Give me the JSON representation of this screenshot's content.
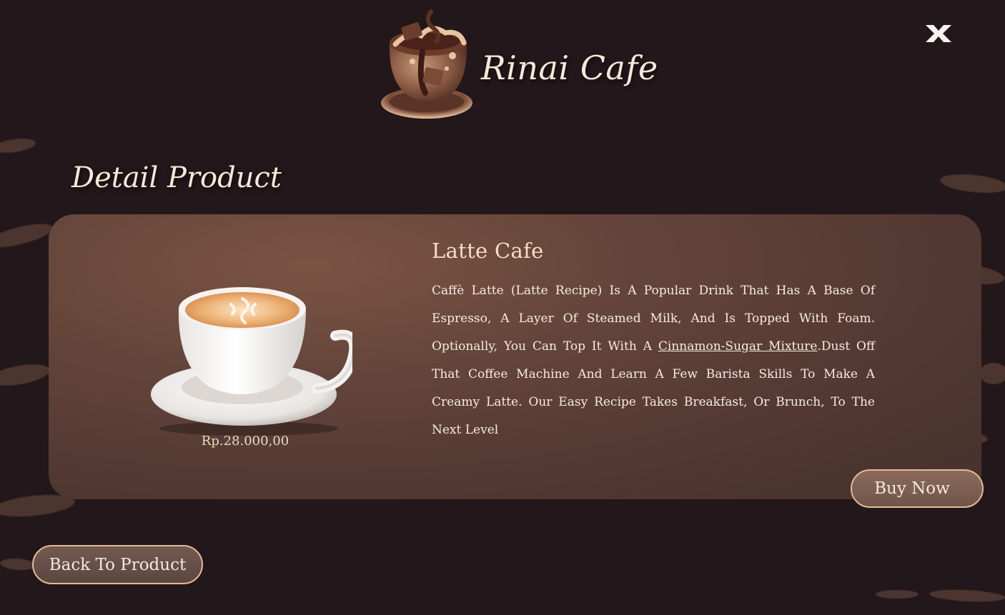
{
  "header": {
    "brand_name": "Rinai Cafe",
    "logo_icon": "coffee-cup-logo-icon",
    "close_icon": "close-icon"
  },
  "page": {
    "heading": "Detail Product"
  },
  "product": {
    "name": "Latte Cafe",
    "price": "Rp.28.000,00",
    "image_icon": "latte-cup-image",
    "description_before_link": "Caffè Latte (Latte Recipe) Is A Popular Drink That Has A Base Of Espresso, A Layer Of Steamed Milk, And Is Topped With Foam. Optionally, You Can Top It With A ",
    "description_link": "Cinnamon-Sugar Mixture",
    "description_after_link": ".Dust Off That Coffee Machine And Learn A Few Barista Skills To Make A Creamy Latte. Our Easy Recipe Takes Breakfast, Or Brunch, To The Next Level"
  },
  "actions": {
    "buy_label": "Buy Now",
    "back_label": "Back To Product"
  },
  "colors": {
    "background": "#22171a",
    "card": "#63443a",
    "accent_border": "#e2bb95",
    "text": "#f3e2cc"
  }
}
